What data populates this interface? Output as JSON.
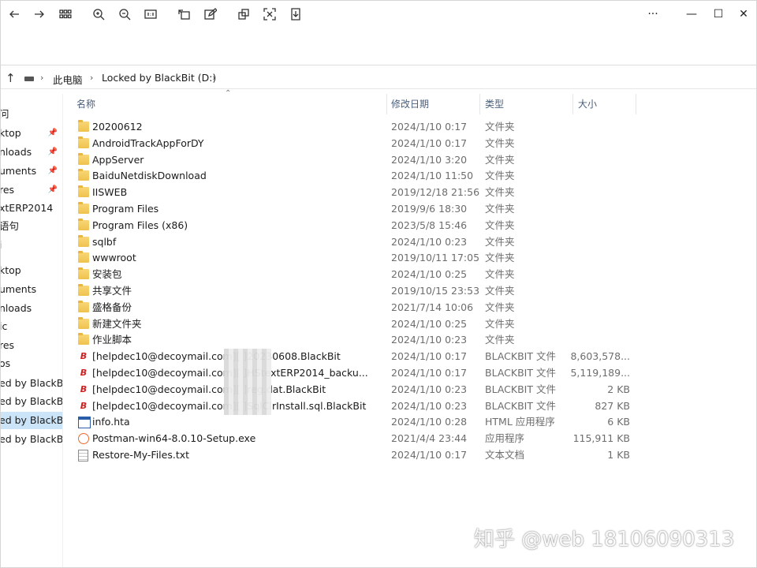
{
  "toolbar": {
    "more_label": "···",
    "minimize_label": "—",
    "maximize_label": "☐",
    "close_label": "✕"
  },
  "address": {
    "crumbs": [
      "此电脑",
      "Locked by BlackBit (D:)"
    ]
  },
  "sidebar": {
    "items": [
      {
        "label": "问",
        "pinned": false
      },
      {
        "label": "ktop",
        "pinned": true
      },
      {
        "label": "nloads",
        "pinned": true
      },
      {
        "label": "uments",
        "pinned": true
      },
      {
        "label": "res",
        "pinned": true
      },
      {
        "label": "xtERP2014",
        "pinned": false
      },
      {
        "label": "语句",
        "pinned": false
      },
      {
        "label": "i",
        "pinned": false
      },
      {
        "label": "ktop",
        "pinned": false
      },
      {
        "label": "uments",
        "pinned": false
      },
      {
        "label": "nloads",
        "pinned": false
      },
      {
        "label": "ic",
        "pinned": false
      },
      {
        "label": "res",
        "pinned": false
      },
      {
        "label": "os",
        "pinned": false
      },
      {
        "label": "ed by BlackB",
        "pinned": false
      },
      {
        "label": "ed by BlackB",
        "pinned": false
      },
      {
        "label": "ed by BlackB",
        "pinned": false,
        "selected": true
      },
      {
        "label": "ed by BlackB",
        "pinned": false
      }
    ]
  },
  "columns": {
    "name": "名称",
    "date": "修改日期",
    "type": "类型",
    "size": "大小"
  },
  "files": [
    {
      "icon": "folder-icon",
      "name": "20200612",
      "date": "2024/1/10 0:17",
      "type": "文件夹",
      "size": ""
    },
    {
      "icon": "folder-icon",
      "name": "AndroidTrackAppForDY",
      "date": "2024/1/10 0:17",
      "type": "文件夹",
      "size": ""
    },
    {
      "icon": "folder-icon",
      "name": "AppServer",
      "date": "2024/1/10 3:20",
      "type": "文件夹",
      "size": ""
    },
    {
      "icon": "folder-icon",
      "name": "BaiduNetdiskDownload",
      "date": "2024/1/10 11:50",
      "type": "文件夹",
      "size": ""
    },
    {
      "icon": "folder-icon",
      "name": "IISWEB",
      "date": "2019/12/18 21:56",
      "type": "文件夹",
      "size": ""
    },
    {
      "icon": "folder-icon",
      "name": "Program Files",
      "date": "2019/9/6 18:30",
      "type": "文件夹",
      "size": ""
    },
    {
      "icon": "folder-icon",
      "name": "Program Files (x86)",
      "date": "2023/5/8 15:46",
      "type": "文件夹",
      "size": ""
    },
    {
      "icon": "folder-icon",
      "name": "sqlbf",
      "date": "2024/1/10 0:23",
      "type": "文件夹",
      "size": ""
    },
    {
      "icon": "folder-icon",
      "name": "wwwroot",
      "date": "2019/10/11 17:05",
      "type": "文件夹",
      "size": ""
    },
    {
      "icon": "folder-icon",
      "name": "安装包",
      "date": "2024/1/10 0:25",
      "type": "文件夹",
      "size": ""
    },
    {
      "icon": "folder-icon",
      "name": "共享文件",
      "date": "2019/10/15 23:53",
      "type": "文件夹",
      "size": ""
    },
    {
      "icon": "folder-icon",
      "name": "盛格备份",
      "date": "2021/7/14 10:06",
      "type": "文件夹",
      "size": ""
    },
    {
      "icon": "folder-icon",
      "name": "新建文件夹",
      "date": "2024/1/10 0:25",
      "type": "文件夹",
      "size": ""
    },
    {
      "icon": "folder-icon",
      "name": "作业脚本",
      "date": "2024/1/10 0:23",
      "type": "文件夹",
      "size": ""
    },
    {
      "icon": "blackbit-icon",
      "name": "[helpdec10@decoymail.com][                ]20230608.BlackBit",
      "date": "2024/1/10 0:17",
      "type": "BLACKBIT 文件",
      "size": "8,603,578..."
    },
    {
      "icon": "blackbit-icon",
      "name": "[helpdec10@decoymail.com][                ]HStextERP2014_backu...",
      "date": "2024/1/10 0:17",
      "type": "BLACKBIT 文件",
      "size": "5,119,189..."
    },
    {
      "icon": "blackbit-icon",
      "name": "[helpdec10@decoymail.com][                ]reg.dat.BlackBit",
      "date": "2024/1/10 0:23",
      "type": "BLACKBIT 文件",
      "size": "2 KB"
    },
    {
      "icon": "blackbit-icon",
      "name": "[helpdec10@decoymail.com][                ]SqlClrInstall.sql.BlackBit",
      "date": "2024/1/10 0:23",
      "type": "BLACKBIT 文件",
      "size": "827 KB"
    },
    {
      "icon": "hta-icon",
      "name": "info.hta",
      "date": "2024/1/10 0:28",
      "type": "HTML 应用程序",
      "size": "6 KB"
    },
    {
      "icon": "exe-icon",
      "name": "Postman-win64-8.0.10-Setup.exe",
      "date": "2021/4/4 23:44",
      "type": "应用程序",
      "size": "115,911 KB"
    },
    {
      "icon": "txt-icon",
      "name": "Restore-My-Files.txt",
      "date": "2024/1/10 0:17",
      "type": "文本文档",
      "size": "1 KB"
    }
  ],
  "watermark": "知乎 @web 18106090313"
}
